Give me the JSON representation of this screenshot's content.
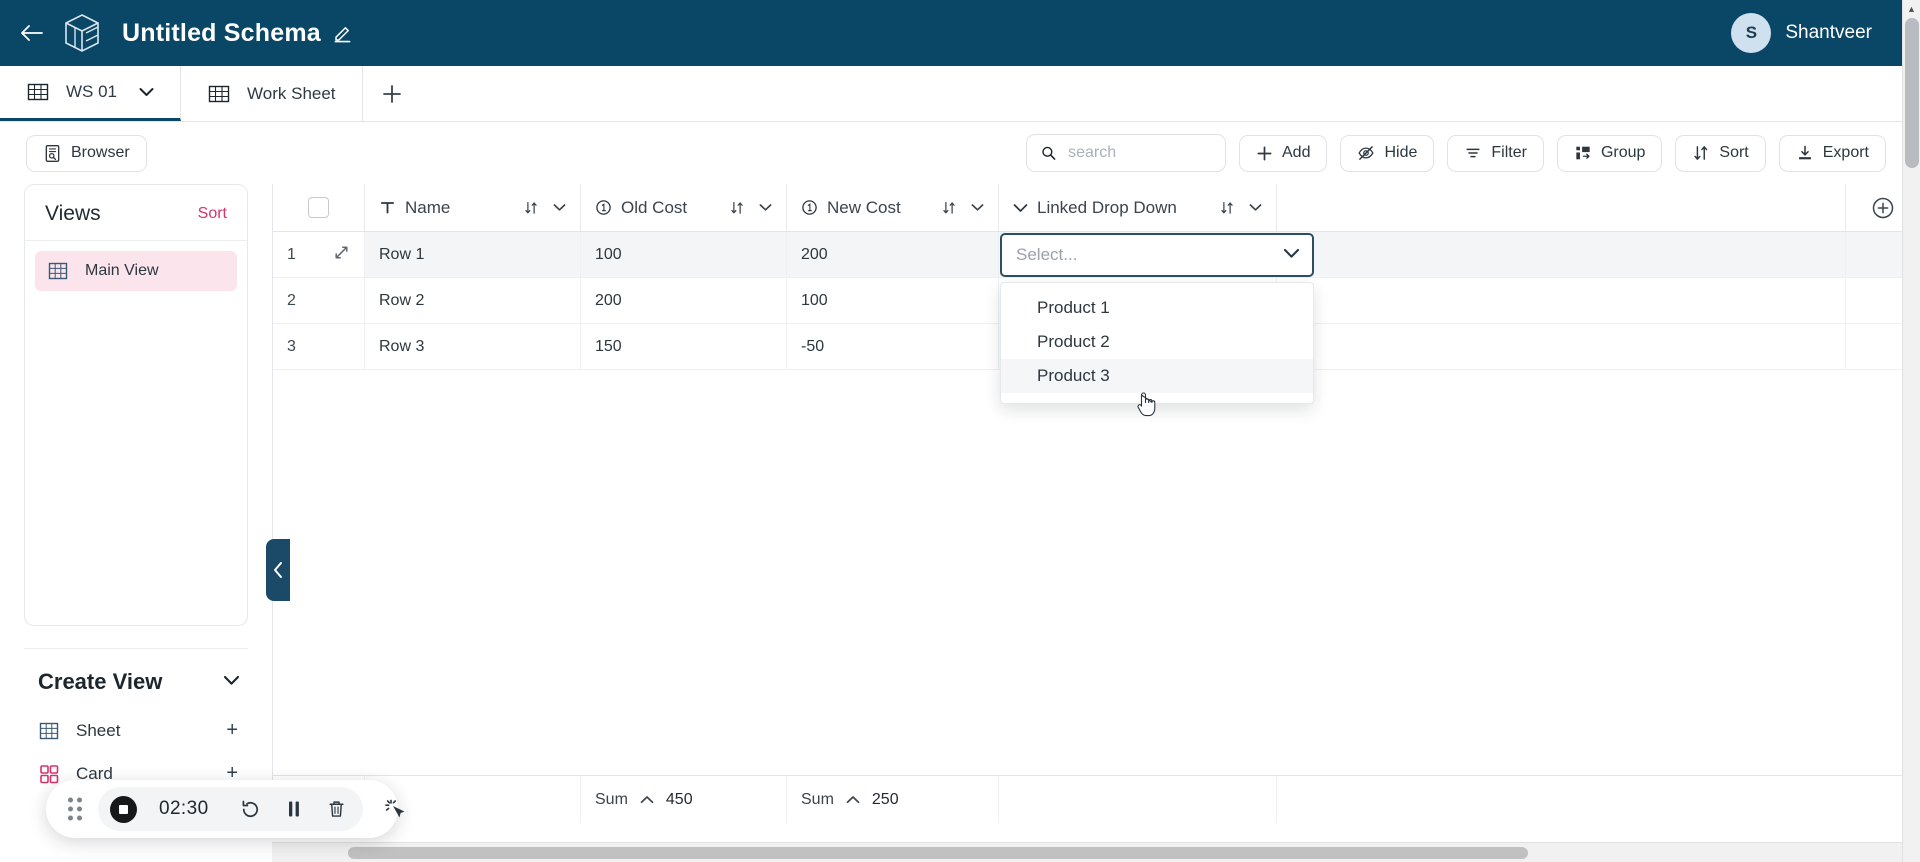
{
  "header": {
    "back_icon": "arrow-left-icon",
    "logo_icon": "cube-logo-icon",
    "title": "Untitled Schema",
    "edit_icon": "pencil-icon",
    "user": {
      "initial": "S",
      "name": "Shantveer"
    }
  },
  "tabs": {
    "items": [
      {
        "label": "WS 01",
        "icon": "table-icon",
        "active": true,
        "has_chevron": true
      },
      {
        "label": "Work Sheet",
        "icon": "table-icon",
        "active": false,
        "has_chevron": false
      }
    ],
    "add_label": "+"
  },
  "toolbar": {
    "browser_label": "Browser",
    "search": {
      "value": "",
      "placeholder": "search"
    },
    "buttons": [
      {
        "label": "Add",
        "icon": "plus-icon"
      },
      {
        "label": "Hide",
        "icon": "eye-off-icon"
      },
      {
        "label": "Filter",
        "icon": "filter-icon"
      },
      {
        "label": "Group",
        "icon": "group-icon"
      },
      {
        "label": "Sort",
        "icon": "sort-icon"
      },
      {
        "label": "Export",
        "icon": "download-icon"
      }
    ]
  },
  "sidebar": {
    "views_title": "Views",
    "views_sort": "Sort",
    "views": [
      {
        "label": "Main View",
        "icon": "grid-icon",
        "selected": true
      }
    ],
    "create_view": {
      "title": "Create View",
      "chevron": "chevron-down-icon",
      "items": [
        {
          "label": "Sheet",
          "icon": "grid-icon",
          "action": "+"
        },
        {
          "label": "Card",
          "icon": "card-icon",
          "action": "+"
        }
      ]
    },
    "collapse_icon": "chevron-left-icon"
  },
  "grid": {
    "columns": [
      {
        "label": "Name",
        "type_icon": "text-type-icon"
      },
      {
        "label": "Old Cost",
        "type_icon": "number-type-icon"
      },
      {
        "label": "New Cost",
        "type_icon": "number-type-icon"
      },
      {
        "label": "Linked Drop Down",
        "type_icon": "chevron-down-icon"
      }
    ],
    "add_column_icon": "circle-plus-icon",
    "rows": [
      {
        "num": "1",
        "name": "Row 1",
        "old_cost": "100",
        "new_cost": "200",
        "linked": ""
      },
      {
        "num": "2",
        "name": "Row 2",
        "old_cost": "200",
        "new_cost": "100",
        "linked": ""
      },
      {
        "num": "3",
        "name": "Row 3",
        "old_cost": "150",
        "new_cost": "-50",
        "linked": ""
      }
    ],
    "summary": [
      {
        "label": "Sum",
        "value": "450"
      },
      {
        "label": "Sum",
        "value": "250"
      }
    ]
  },
  "dropdown": {
    "placeholder": "Select...",
    "caret_icon": "chevron-down-icon",
    "options": [
      {
        "label": "Product 1",
        "hovered": false
      },
      {
        "label": "Product 2",
        "hovered": false
      },
      {
        "label": "Product 3",
        "hovered": true
      }
    ]
  },
  "recorder": {
    "time": "02:30",
    "stop_icon": "stop-record-icon",
    "restart_icon": "restart-icon",
    "pause_icon": "pause-icon",
    "delete_icon": "trash-icon",
    "effects_icon": "click-highlight-icon",
    "drag_icon": "drag-handle-icon"
  },
  "colors": {
    "brand_navy": "#0a4766",
    "accent_pink": "#d6336c",
    "selected_row_bg": "#fbe4ec",
    "dropdown_border": "#2d4f66"
  }
}
